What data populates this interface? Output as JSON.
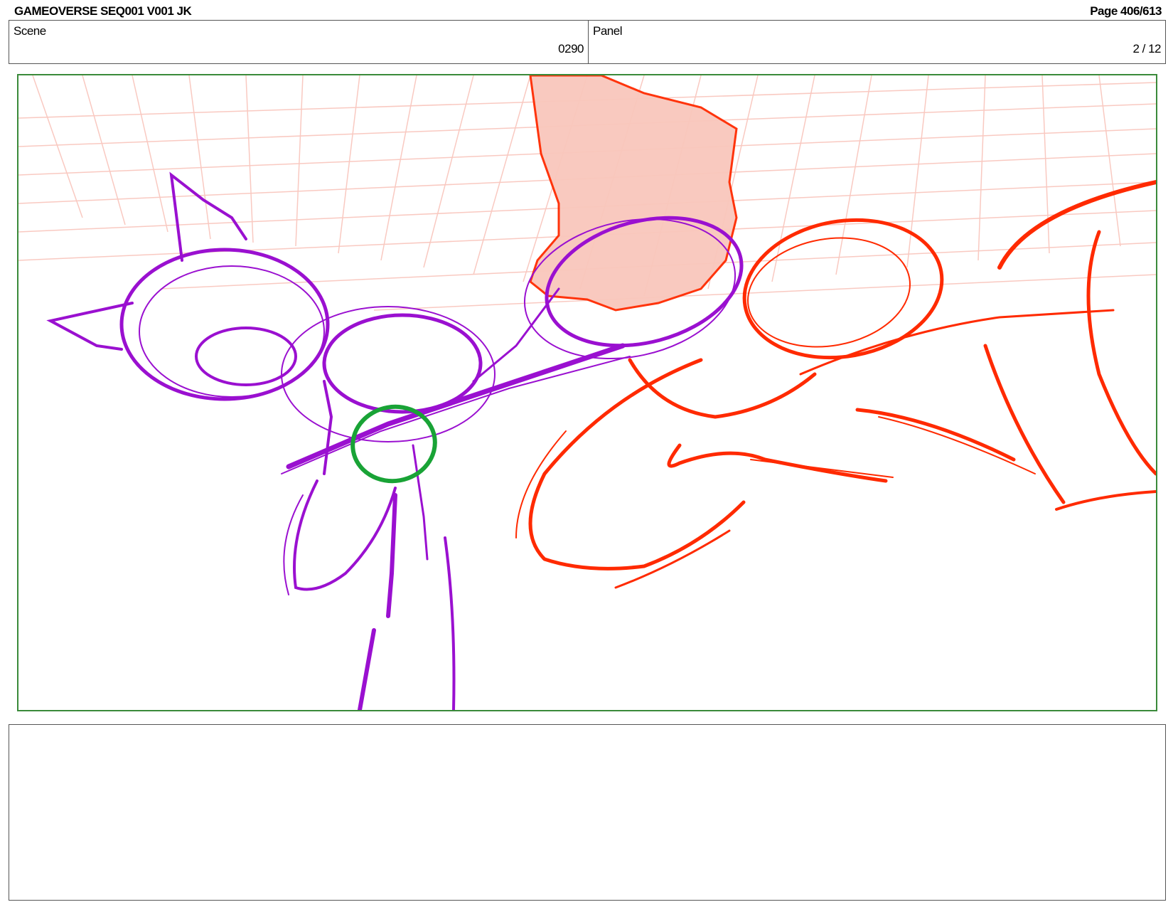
{
  "header": {
    "title": "GAMEOVERSE SEQ001 V001 JK",
    "page": "Page 406/613"
  },
  "info": {
    "scene_label": "Scene",
    "scene_value": "0290",
    "panel_label": "Panel",
    "panel_value": "2 / 12"
  },
  "notes": {
    "text": ""
  },
  "colors": {
    "frame_border": "#3a8a3a",
    "character_left": "#9a10d0",
    "character_right": "#ff2a00",
    "shape_fill": "#f9c7bc",
    "grid": "#f7b8ad",
    "accent_circle": "#19a336"
  }
}
